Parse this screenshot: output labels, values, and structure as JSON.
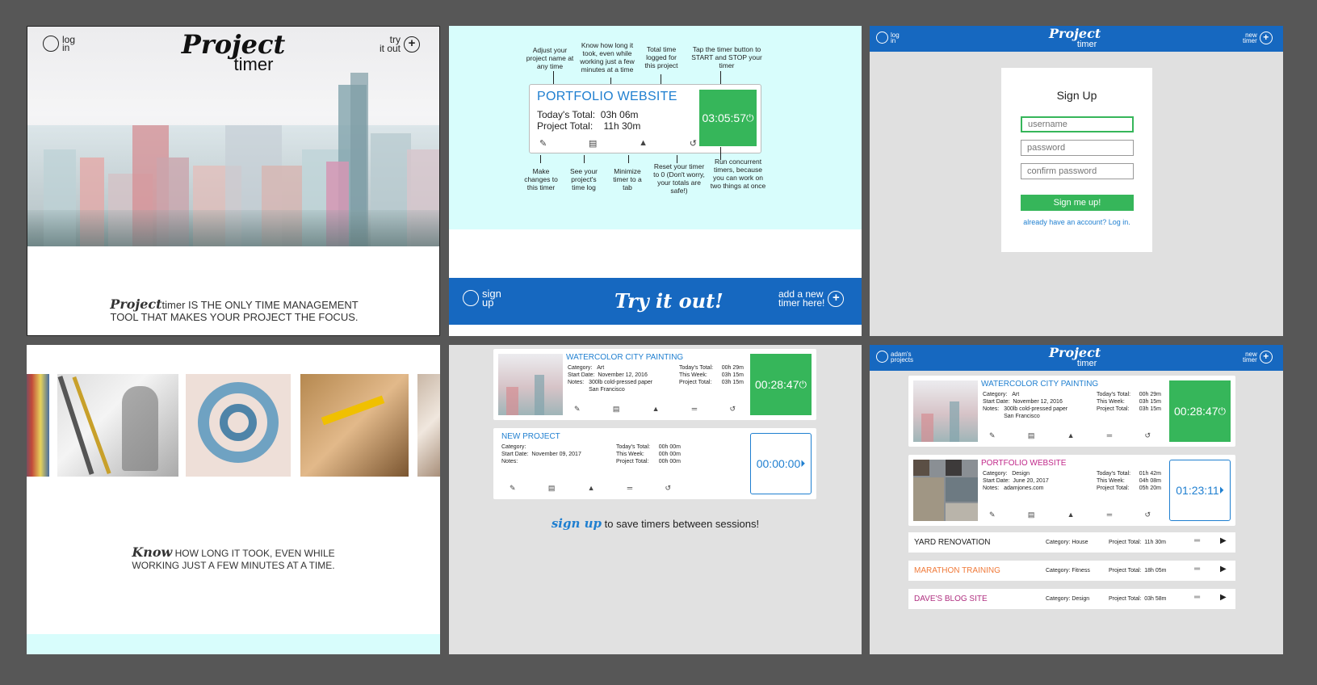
{
  "brand": {
    "word1": "Project",
    "word2": "timer"
  },
  "p1": {
    "login": "log\nin",
    "tryout": "try\nit out",
    "tag_line1": "timer IS THE ONLY TIME MANAGEMENT",
    "tag_line2": "TOOL THAT MAKES YOUR PROJECT THE FOCUS."
  },
  "p2": {
    "title": "PORTFOLIO WEBSITE",
    "today_label": "Today's Total:",
    "today": "03h 06m",
    "proj_label": "Project Total:",
    "proj": "11h 30m",
    "timer": "03:05:57",
    "a1": "Adjust your project name at any time",
    "a2": "Know how long it took, even while working just a few minutes at a time",
    "a3": "Total time logged for this project",
    "a4": "Tap the timer button to START and STOP your timer",
    "b1": "Make changes to this timer",
    "b2": "See your project's time log",
    "b3": "Minimize timer to a tab",
    "b4": "Reset your timer to 0 (Don't worry, your totals are safe!)",
    "b5": "Run concurrent timers, because you can work on two things at once",
    "signup": "sign\nup",
    "tryit": "Try it out!",
    "addnew": "add a new\ntimer here!"
  },
  "p3": {
    "login": "log\nin",
    "newtimer": "new\ntimer",
    "title": "Sign Up",
    "username_ph": "username",
    "password_ph": "password",
    "confirm_ph": "confirm password",
    "button": "Sign me up!",
    "link": "already have an account? Log in."
  },
  "p4": {
    "know": "Know",
    "line1": "HOW LONG IT TOOK, EVEN WHILE",
    "line2": "WORKING JUST A FEW MINUTES AT A TIME."
  },
  "timer1": {
    "title": "WATERCOLOR CITY PAINTING",
    "cat_label": "Category:",
    "cat": "Art",
    "start_label": "Start Date:",
    "start": "November 12, 2016",
    "notes_label": "Notes:",
    "notes": "300lb cold-pressed paper\nSan Francisco",
    "today_label": "Today's Total:",
    "today": "00h 29m",
    "week_label": "This Week:",
    "week": "03h 15m",
    "proj_label": "Project Total:",
    "proj": "03h 15m",
    "time": "00:28:47"
  },
  "timer2": {
    "title": "NEW PROJECT",
    "cat_label": "Category:",
    "start_label": "Start Date:",
    "start": "November 09, 2017",
    "notes_label": "Notes:",
    "today_label": "Today's Total:",
    "today": "00h 00m",
    "week_label": "This Week:",
    "week": "00h 00m",
    "proj_label": "Project Total:",
    "proj": "00h 00m",
    "time": "00:00:00"
  },
  "p5": {
    "signup": "sign up",
    "save": "to save timers between sessions!"
  },
  "p6": {
    "user": "adam's\nprojects",
    "newtimer": "new\ntimer",
    "timer2": {
      "title": "PORTFOLIO WEBSITE",
      "cat": "Design",
      "start": "June 20, 2017",
      "notes": "adamjones.com",
      "today": "01h 42m",
      "week": "04h 08m",
      "proj": "05h 20m",
      "time": "01:23:11"
    },
    "rows": [
      {
        "name": "YARD RENOVATION",
        "cat": "House",
        "proj": "11h 30m"
      },
      {
        "name": "MARATHON TRAINING",
        "cat": "Fitness",
        "proj": "18h 05m"
      },
      {
        "name": "DAVE'S BLOG SITE",
        "cat": "Design",
        "proj": "03h 58m"
      }
    ],
    "cat_label": "Category:",
    "proj_label": "Project Total:"
  },
  "colors": {
    "header_blue": "#1668c0",
    "timer_green": "#36b65a",
    "title_blue": "#1f7fd0",
    "marathon": "#f07a3a",
    "dave": "#b03080",
    "portfolio": "#c0288a"
  }
}
